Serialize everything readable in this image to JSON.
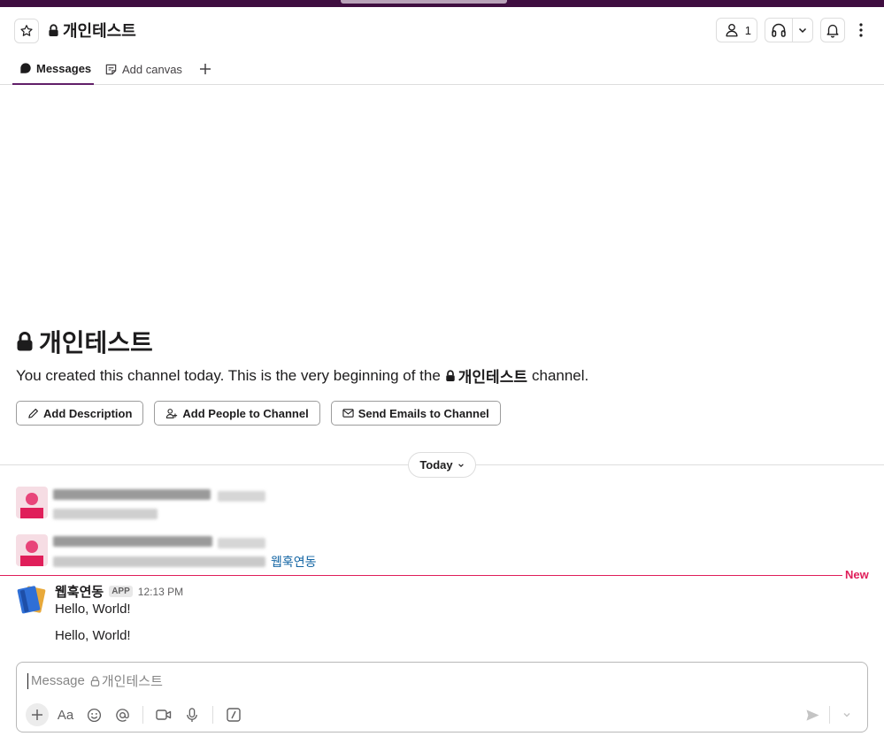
{
  "colors": {
    "accent": "#611f69",
    "new_divider": "#e01e5a",
    "link": "#1264a3",
    "topbar": "#3f0e40"
  },
  "header": {
    "channel_name": "개인테스트",
    "member_count": "1"
  },
  "tabs": [
    {
      "label": "Messages",
      "icon": "message-bubble-icon",
      "active": true
    },
    {
      "label": "Add canvas",
      "icon": "canvas-icon",
      "active": false
    }
  ],
  "intro": {
    "title": "개인테스트",
    "desc_before": "You created this channel today. This is the very beginning of the",
    "desc_channel": "개인테스트",
    "desc_after": "channel.",
    "actions": [
      {
        "label": "Add Description",
        "icon": "pencil-icon"
      },
      {
        "label": "Add People to Channel",
        "icon": "add-person-icon"
      },
      {
        "label": "Send Emails to Channel",
        "icon": "email-icon"
      }
    ]
  },
  "day_divider": {
    "label": "Today"
  },
  "blurred_messages": [
    {
      "link_text": ""
    },
    {
      "link_text": "웹훅연동"
    }
  ],
  "new_divider": {
    "label": "New"
  },
  "message": {
    "sender": "웹훅연동",
    "badge": "APP",
    "time": "12:13 PM",
    "lines": [
      "Hello, World!",
      "Hello, World!"
    ]
  },
  "composer": {
    "placeholder_prefix": "Message",
    "placeholder_channel": "개인테스트",
    "tools": [
      "plus-icon",
      "formatting-icon",
      "emoji-icon",
      "mention-icon",
      "video-icon",
      "microphone-icon",
      "slash-command-icon"
    ],
    "send_icon": "send-icon"
  }
}
